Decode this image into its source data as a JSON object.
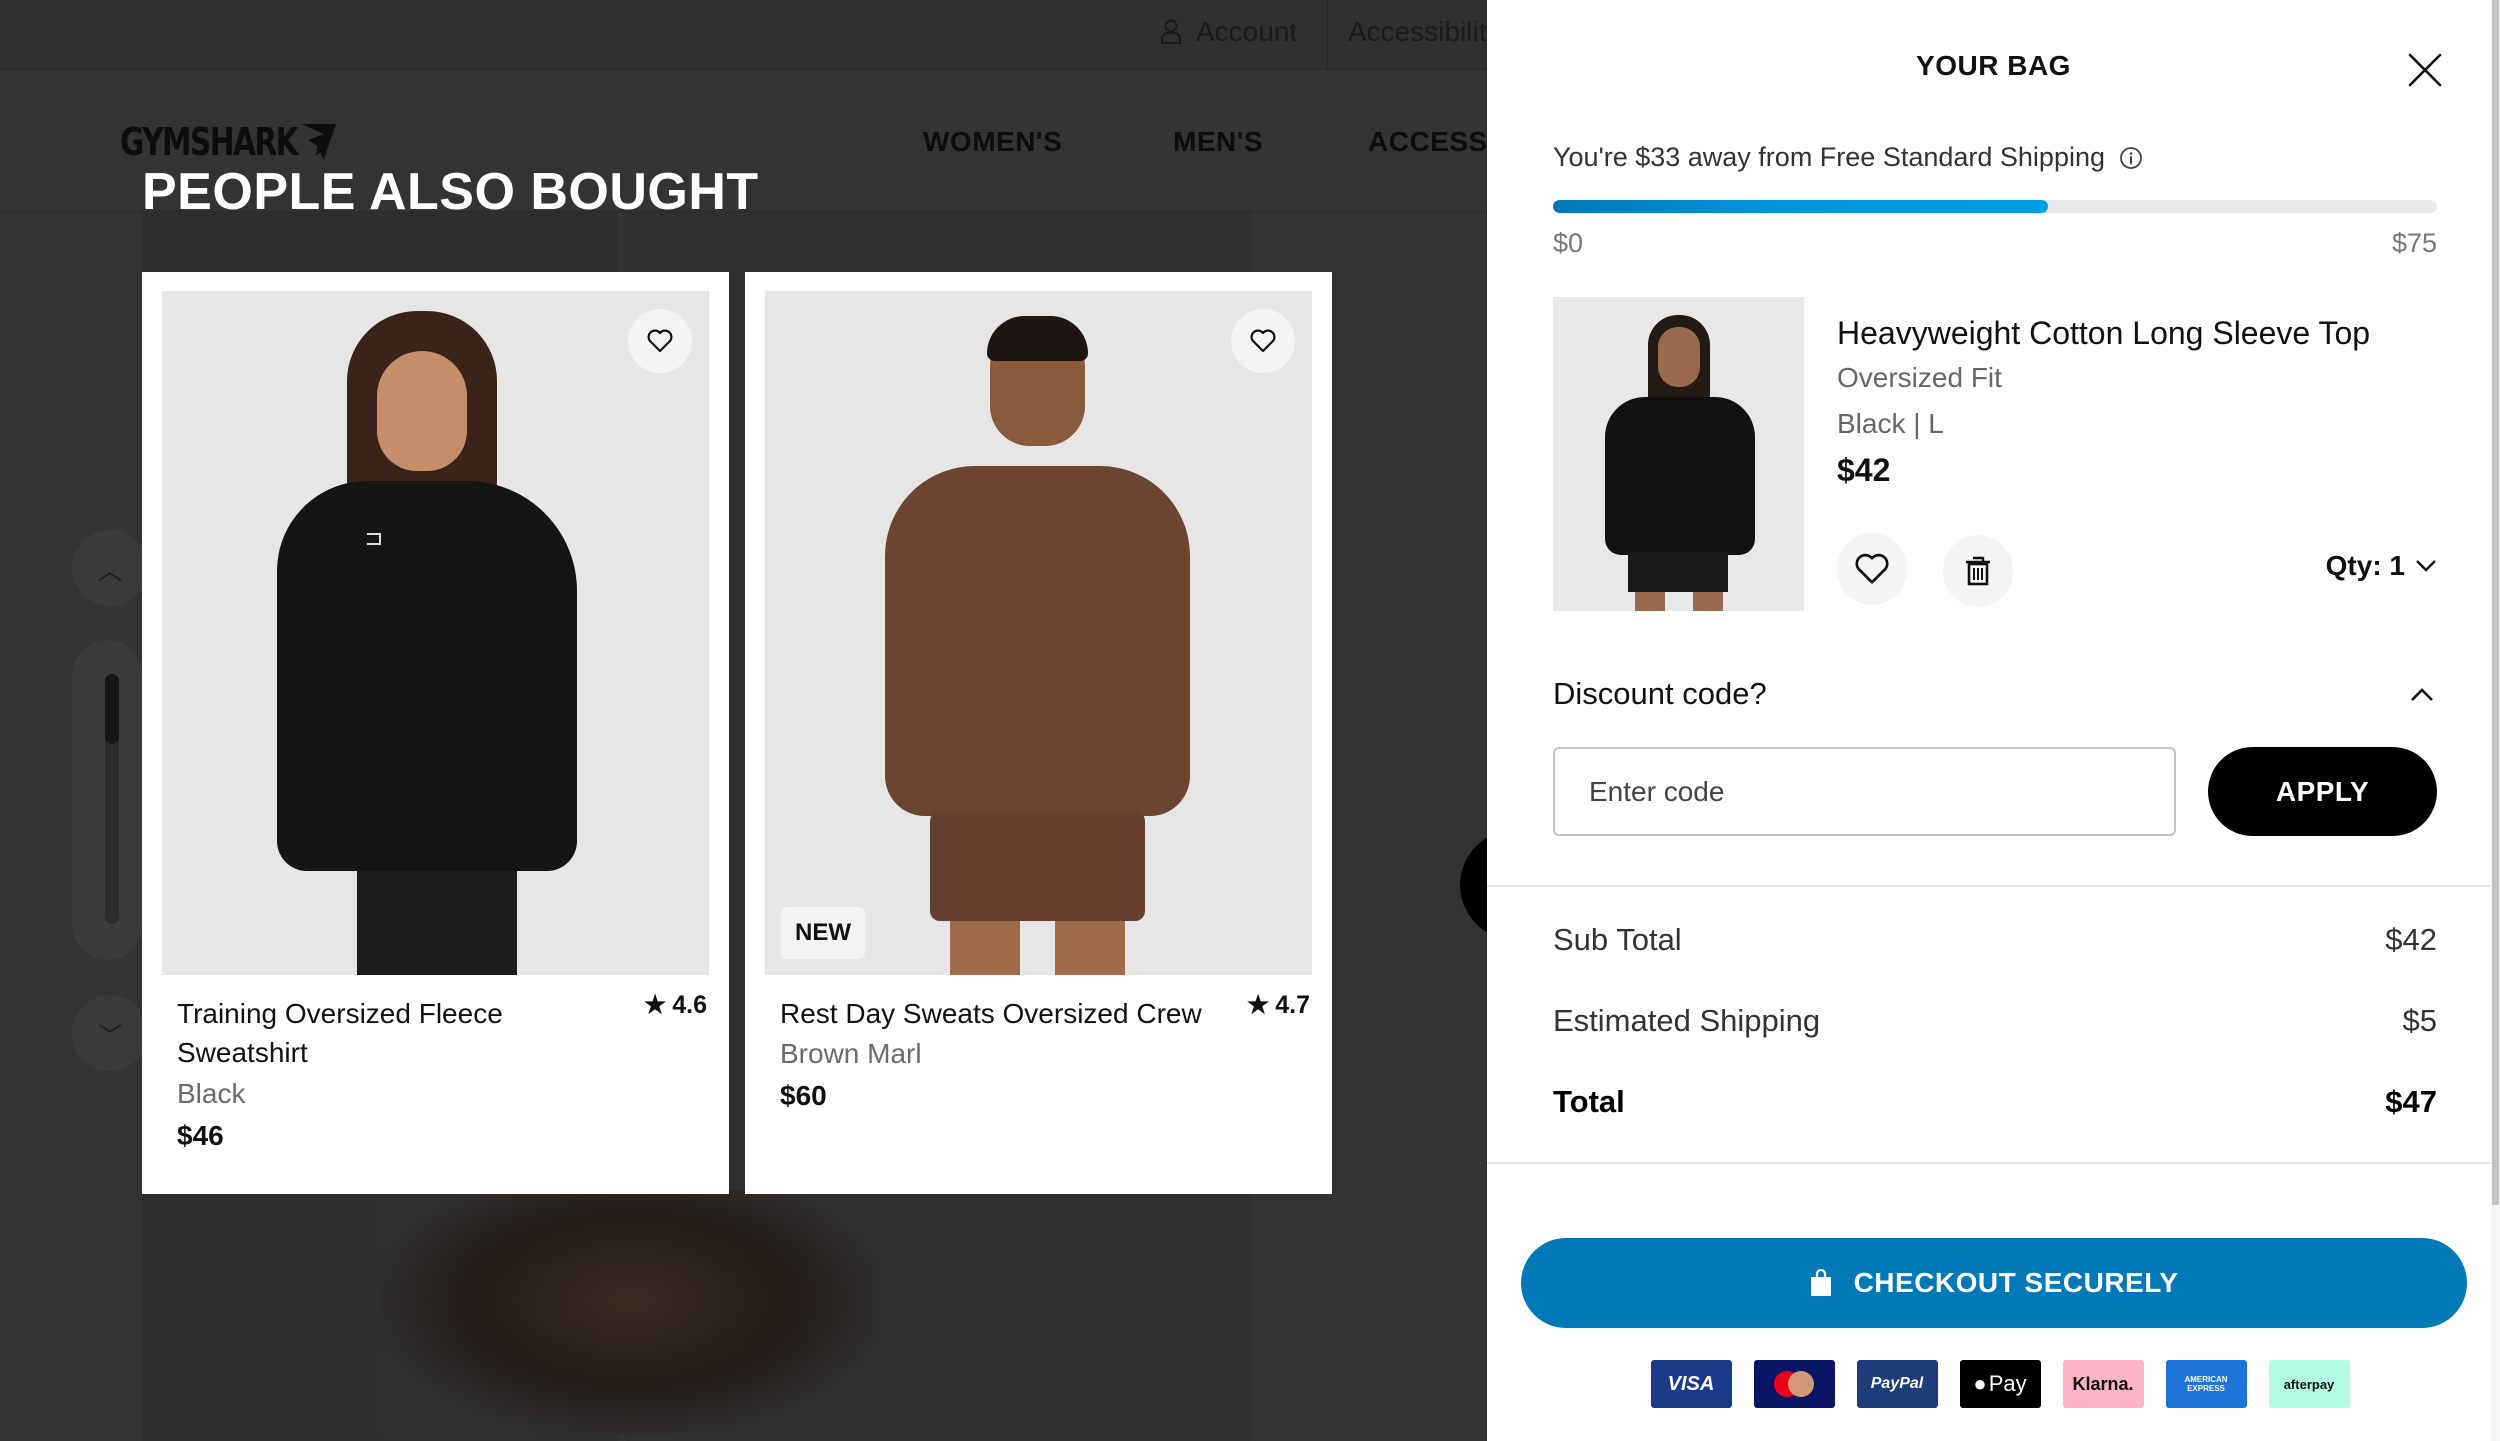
{
  "background_page": {
    "topbar": {
      "account_label": "Account",
      "accessibility_label": "Accessibility"
    },
    "logo_text": "GYMSHARK",
    "nav": [
      "WOMEN'S",
      "MEN'S",
      "ACCESSORIES"
    ],
    "carousel_up_icon": "chevron-up",
    "carousel_down_icon": "chevron-down"
  },
  "people_also_bought": {
    "title": "PEOPLE ALSO BOUGHT",
    "products": [
      {
        "name": "Training Oversized Fleece Sweatshirt",
        "color": "Black",
        "price": "$46",
        "rating": "4.6",
        "badge": "",
        "wishlist_icon": "heart-outline"
      },
      {
        "name": "Rest Day Sweats Oversized Crew",
        "color": "Brown Marl",
        "price": "$60",
        "rating": "4.7",
        "badge": "NEW",
        "wishlist_icon": "heart-outline"
      }
    ]
  },
  "bag": {
    "title": "YOUR BAG",
    "close_icon": "close-x",
    "free_shipping": {
      "message": "You're $33 away from Free Standard Shipping",
      "info_icon": "info-circle",
      "current_value": 42,
      "threshold_value": 75,
      "progress_fraction": 0.56,
      "min_label": "$0",
      "max_label": "$75"
    },
    "items": [
      {
        "name": "Heavyweight Cotton Long Sleeve Top",
        "fit": "Oversized Fit",
        "variant": "Black | L",
        "price": "$42",
        "quantity_label": "Qty: 1",
        "wishlist_icon": "heart-outline",
        "delete_icon": "trash"
      }
    ],
    "discount": {
      "label": "Discount code?",
      "toggle_icon": "chevron-up",
      "input_placeholder": "Enter code",
      "input_value": "",
      "apply_label": "APPLY"
    },
    "summary": [
      {
        "label": "Sub Total",
        "value": "$42"
      },
      {
        "label": "Estimated Shipping",
        "value": "$5"
      },
      {
        "label": "Total",
        "value": "$47"
      }
    ],
    "checkout_label": "CHECKOUT SECURELY",
    "checkout_icon": "shopping-bag",
    "payment_methods": [
      "VISA",
      "Mastercard",
      "PayPal",
      "Pay",
      "Klarna.",
      "AMERICAN EXPRESS",
      "afterpay"
    ]
  },
  "colors": {
    "overlay_bg": "#333333",
    "checkout_blue": "#0079b6",
    "progress_blue": "#009ee6",
    "apply_black": "#000000"
  }
}
